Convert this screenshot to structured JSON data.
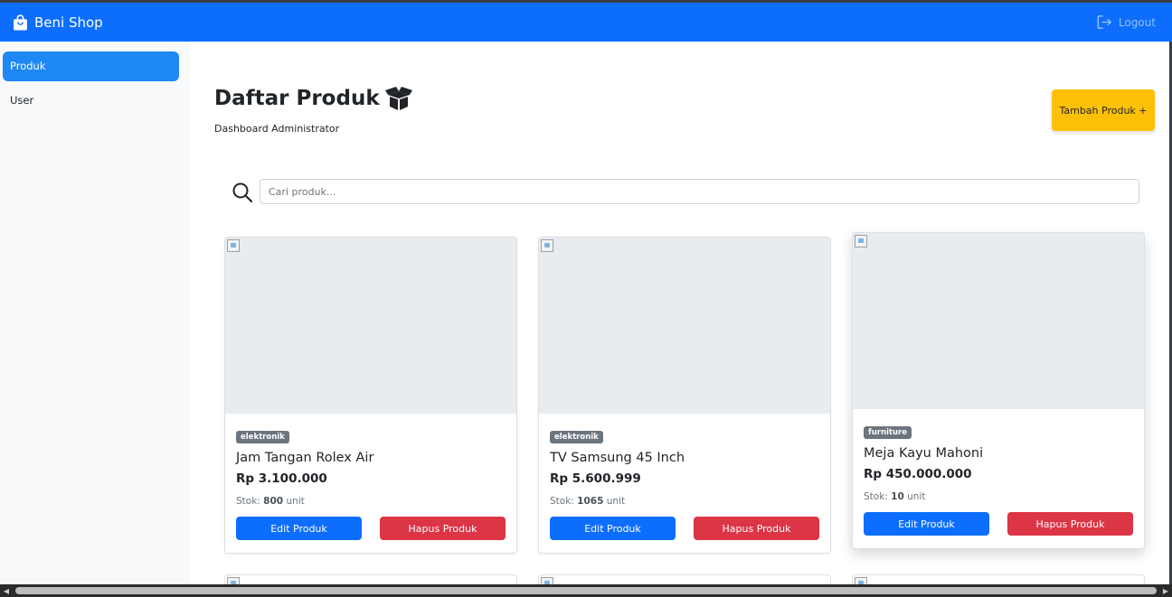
{
  "navbar": {
    "brand": "Beni Shop",
    "logout_label": "Logout"
  },
  "sidebar": {
    "items": [
      {
        "label": "Produk",
        "active": true
      },
      {
        "label": "User",
        "active": false
      }
    ]
  },
  "header": {
    "title": "Daftar Produk",
    "subtitle": "Dashboard Administrator",
    "add_button": "Tambah Produk +"
  },
  "search": {
    "placeholder": "Cari produk...",
    "value": ""
  },
  "products": [
    {
      "category": "elektronik",
      "name": "Jam Tangan Rolex Air",
      "price": "Rp 3.100.000",
      "stock_prefix": "Stok:",
      "stock_value": "800",
      "stock_unit": "unit",
      "edit_label": "Edit Produk",
      "delete_label": "Hapus Produk"
    },
    {
      "category": "elektronik",
      "name": "TV Samsung 45 Inch",
      "price": "Rp 5.600.999",
      "stock_prefix": "Stok:",
      "stock_value": "1065",
      "stock_unit": "unit",
      "edit_label": "Edit Produk",
      "delete_label": "Hapus Produk"
    },
    {
      "category": "furniture",
      "name": "Meja Kayu Mahoni",
      "price": "Rp 450.000.000",
      "stock_prefix": "Stok:",
      "stock_value": "10",
      "stock_unit": "unit",
      "edit_label": "Edit Produk",
      "delete_label": "Hapus Produk"
    }
  ],
  "colors": {
    "primary": "#0d6efd",
    "warning": "#ffc107",
    "danger": "#dc3545",
    "secondary": "#6c757d"
  },
  "icons": {
    "brand": "shopping-bag-icon",
    "logout": "logout-icon",
    "title": "box-open-icon",
    "search": "search-icon"
  }
}
